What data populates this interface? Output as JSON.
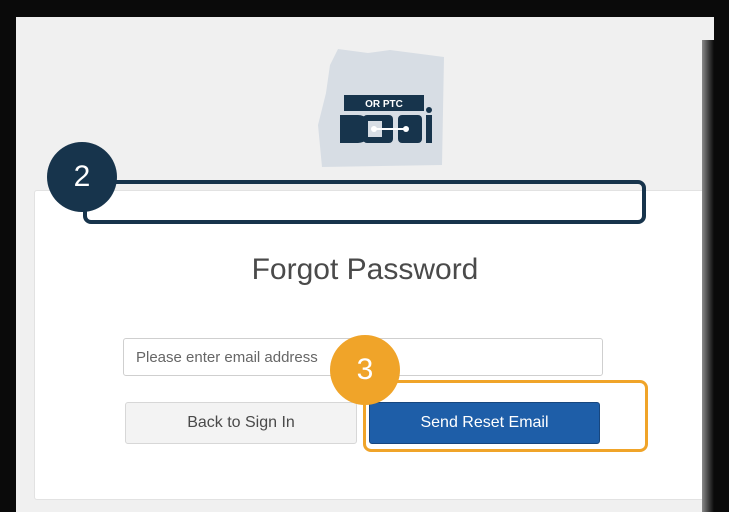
{
  "logo": {
    "banner_text": "OR PTC",
    "mark_text": "DCI"
  },
  "annotations": {
    "step_two": "2",
    "step_three": "3"
  },
  "form": {
    "title": "Forgot Password",
    "email_placeholder": "Please enter email address",
    "back_button": "Back to Sign In",
    "send_button": "Send Reset Email"
  },
  "colors": {
    "navy": "#17344c",
    "orange": "#f0a429",
    "primary_button": "#1e5ea8"
  }
}
